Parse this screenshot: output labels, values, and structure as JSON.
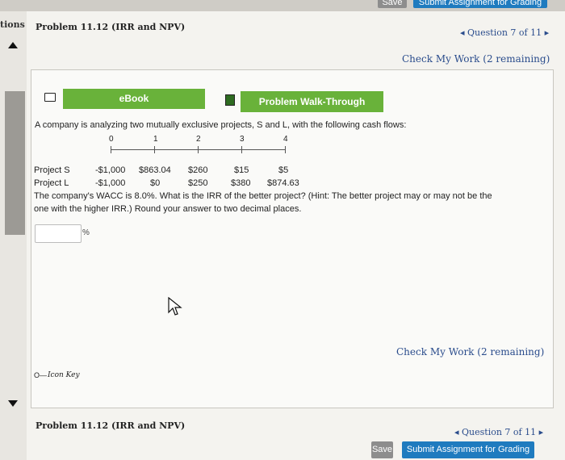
{
  "topbar": {
    "save_label": "Save",
    "submit_label": "Submit Assignment for Grading"
  },
  "sidebar": {
    "label": "tions"
  },
  "header": {
    "title": "Problem 11.12 (IRR and NPV)",
    "question_nav": "◂ Question 7 of 11 ▸",
    "check_work": "Check My Work (2 remaining)"
  },
  "buttons": {
    "ebook": "eBook",
    "walkthrough": "Problem Walk-Through"
  },
  "problem": {
    "intro": "A company is analyzing two mutually exclusive projects, S and L, with the following cash flows:",
    "periods": [
      "0",
      "1",
      "2",
      "3",
      "4"
    ],
    "projects": [
      {
        "label": "Project S",
        "cashflows": [
          "-$1,000",
          "$863.04",
          "$260",
          "$15",
          "$5"
        ]
      },
      {
        "label": "Project L",
        "cashflows": [
          "-$1,000",
          "$0",
          "$250",
          "$380",
          "$874.63"
        ]
      }
    ],
    "question_line1": "The company's WACC is 8.0%. What is the IRR of the better project? (Hint: The better project may or may not be the",
    "question_line2": "one with the higher IRR.) Round your answer to two decimal places.",
    "answer_value": "",
    "percent_suffix": "%"
  },
  "icon_key": "Icon Key",
  "footer": {
    "check_work": "Check My Work (2 remaining)",
    "title": "Problem 11.12 (IRR and NPV)",
    "question_nav": "◂ Question 7 of 11 ▸",
    "save_label": "Save",
    "submit_label": "Submit Assignment for Grading"
  }
}
